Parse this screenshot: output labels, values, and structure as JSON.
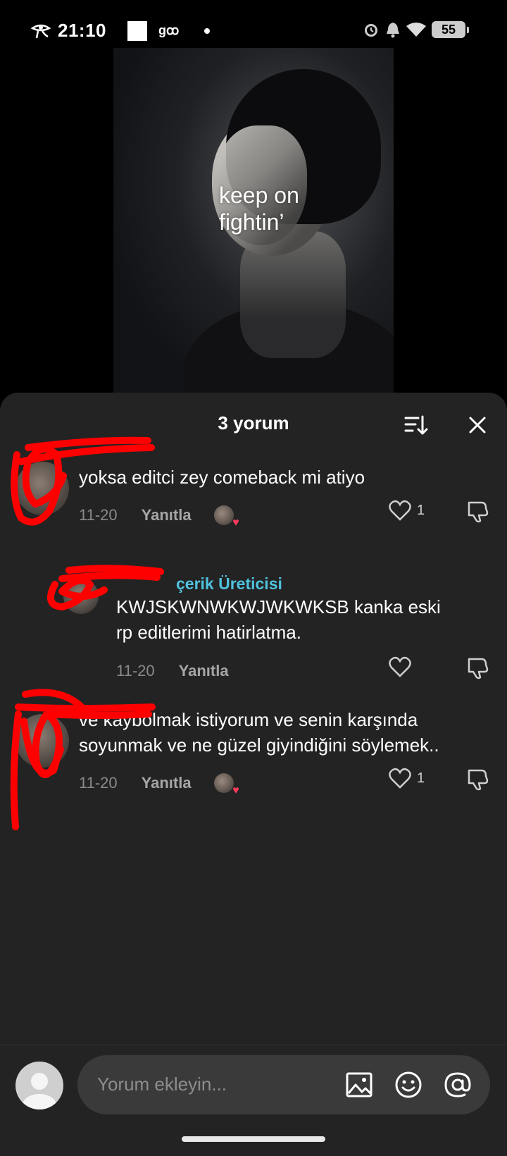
{
  "status_bar": {
    "time": "21:10",
    "carrier_text": "gꝏ",
    "battery": "55",
    "icons": [
      "eye-of-horus-icon",
      "alarm-icon",
      "bell-icon",
      "wifi-icon",
      "battery-icon"
    ]
  },
  "video": {
    "overlay_text_line1": "keep on",
    "overlay_text_line2": "fightin’"
  },
  "comments_sheet": {
    "title": "3 yorum",
    "comments": [
      {
        "text": "yoksa editci zey comeback mi atiyo",
        "date": "11-20",
        "reply_label": "Yanıtla",
        "likes": "1"
      },
      {
        "username_visible": "çerik Üreticisi",
        "text_line1": "KWJSKWNWKWJWKWKSB kanka eski",
        "text_line2": "rp editlerimi hatirlatma.",
        "date": "11-20",
        "reply_label": "Yanıtla",
        "likes": ""
      },
      {
        "text_line1": "ve kaybolmak istiyorum ve senin karşında",
        "text_line2": "soyunmak ve ne güzel giyindiğini söylemek..",
        "date": "11-20",
        "reply_label": "Yanıtla",
        "likes": "1"
      }
    ]
  },
  "composer": {
    "placeholder": "Yorum ekleyin...",
    "icons": [
      "image-icon",
      "emoji-icon",
      "mention-icon"
    ]
  },
  "colors": {
    "sheet_bg": "#232323",
    "creator_accent": "#4fc3dd",
    "scribble": "#ff0000"
  }
}
